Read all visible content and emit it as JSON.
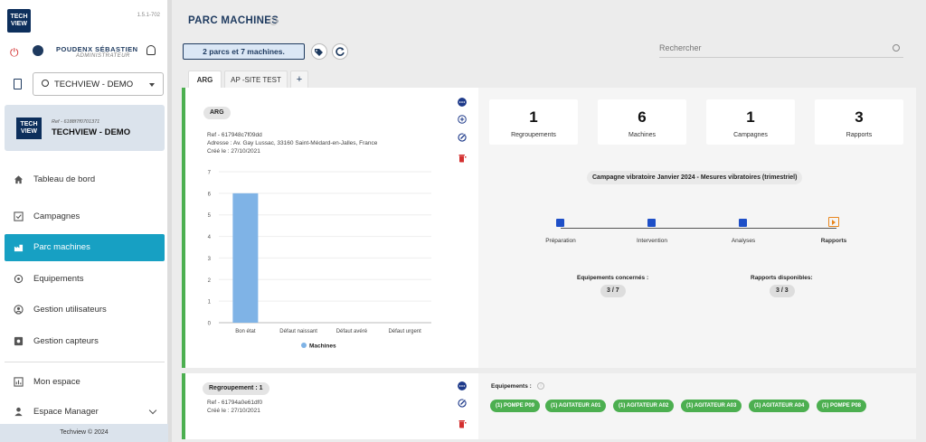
{
  "app": {
    "version": "1.5.1-702",
    "logo_text": "TECH VIEW",
    "footer": "Techview © 2024"
  },
  "user": {
    "name": "POUDENX SÉBASTIEN",
    "role": "ADMINISTRATEUR"
  },
  "site_selector": {
    "value": "TECHVIEW - DEMO"
  },
  "site_card": {
    "ref": "Ref - 6188f7f0701371",
    "name": "TECHVIEW - DEMO"
  },
  "nav": [
    {
      "label": "Tableau de bord",
      "icon": "home-icon"
    },
    {
      "label": "Campagnes",
      "icon": "campaign-icon"
    },
    {
      "label": "Parc machines",
      "icon": "factory-icon",
      "active": true
    },
    {
      "label": "Equipements",
      "icon": "equipment-icon"
    },
    {
      "label": "Gestion utilisateurs",
      "icon": "users-icon"
    },
    {
      "label": "Gestion capteurs",
      "icon": "sensor-icon"
    },
    {
      "label": "Mon espace",
      "icon": "chart-icon"
    },
    {
      "label": "Espace Manager",
      "icon": "manager-icon"
    }
  ],
  "main": {
    "title": "PARC MACHINES",
    "summary": "2 parcs et 7 machines.",
    "search_placeholder": "Rechercher",
    "tabs": [
      "ARG",
      "AP -SITE TEST",
      "+"
    ]
  },
  "park": {
    "name": "ARG",
    "ref": "Ref - 617948c7f09dd",
    "address": "Adresse : Av. Gay Lussac, 33160 Saint-Médard-en-Jalles, France",
    "created": "Créé le : 27/10/2021",
    "stats": [
      {
        "value": "1",
        "label": "Regroupements"
      },
      {
        "value": "6",
        "label": "Machines"
      },
      {
        "value": "1",
        "label": "Campagnes"
      },
      {
        "value": "3",
        "label": "Rapports"
      }
    ],
    "campaign": {
      "title": "Campagne vibratoire Janvier 2024 - Mesures vibratoires (trimestriel)",
      "steps": [
        "Préparation",
        "Intervention",
        "Analyses",
        "Rapports"
      ],
      "equip_label": "Equipements concernés :",
      "equip_value": "3 / 7",
      "reports_label": "Rapports disponibles:",
      "reports_value": "3 / 3"
    }
  },
  "group": {
    "name": "Regroupement : 1",
    "ref": "Ref - 61794a0e61df0",
    "created": "Créé le : 27/10/2021",
    "equip_label": "Equipements :",
    "equipments": [
      "(1) POMPE P09",
      "(1) AGITATEUR A01",
      "(1) AGITATEUR A02",
      "(1) AGITATEUR A03",
      "(1) AGITATEUR A04",
      "(1) POMPE P08"
    ]
  },
  "colors": {
    "accent": "#17a0c3",
    "navy": "#1e3a5f",
    "green": "#4caf50",
    "bar": "#7fb3e6",
    "orange": "#e8861e"
  },
  "chart_data": {
    "type": "bar",
    "categories": [
      "Bon état",
      "Défaut naissant",
      "Défaut avéré",
      "Défaut urgent"
    ],
    "series": [
      {
        "name": "Machines",
        "values": [
          6,
          0,
          0,
          0
        ]
      }
    ],
    "ylim": [
      0,
      7
    ],
    "yticks": [
      0,
      1,
      2,
      3,
      4,
      5,
      6,
      7
    ],
    "legend": "bottom",
    "grid": true
  }
}
